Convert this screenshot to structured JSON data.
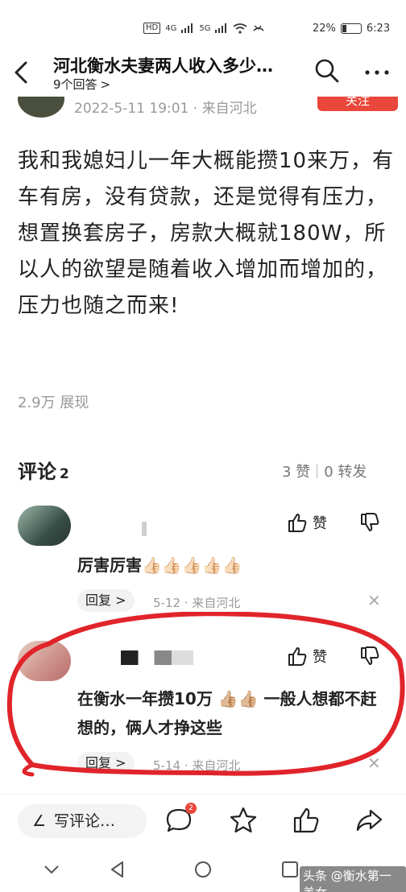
{
  "status_bar": {
    "network_hd": "HD",
    "network_4g": "4G",
    "network_5g": "5G",
    "battery": "22%",
    "battery_level": 0.22,
    "time": "6:23"
  },
  "header": {
    "title": "河北衡水夫妻两人收入多少…",
    "answers": "9个回答",
    "chevron": ">"
  },
  "post": {
    "date_source": "2022-5-11 19:01 · 来自河北",
    "follow_label": "关注",
    "body": "我和我媳妇儿一年大概能攒10来万，有车有房，没有贷款，还是觉得有压力，想置换套房子，房款大概就180W，所以人的欲望是随着收入增加而增加的，压力也随之而来!",
    "views": "2.9万 展现"
  },
  "comments_section": {
    "title": "评论",
    "count": "2",
    "likes": "3 赞",
    "shares": "0 转发"
  },
  "comments": [
    {
      "like_label": "赞",
      "text": "厉害厉害👍🏻👍🏻👍🏻👍🏻👍🏻",
      "reply_label": "回复 >",
      "meta": "5-12 · 来自河北"
    },
    {
      "like_label": "赞",
      "text": "在衡水一年攒10万 👍🏼👍🏼 一般人想都不赶想的，俩人才挣这些",
      "reply_label": "回复 >",
      "meta": "5-14 · 来自河北"
    }
  ],
  "bottom_bar": {
    "write_comment": "写评论…",
    "comment_badge": "2"
  },
  "watermark": "头条 @衡水第一美女",
  "colors": {
    "accent_red": "#e9473b",
    "highlight_red": "#e0242a",
    "meta_gray": "#999999"
  }
}
